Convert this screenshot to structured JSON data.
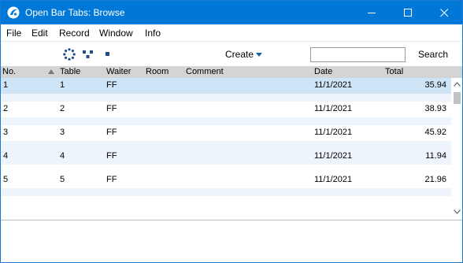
{
  "window": {
    "title": "Open Bar Tabs: Browse",
    "accent_color": "#0078d7",
    "icon": "app-logo-icon",
    "controls": [
      "minimize-icon",
      "maximize-icon",
      "close-icon"
    ]
  },
  "menu": {
    "file": "File",
    "edit": "Edit",
    "record": "Record",
    "window": "Window",
    "info": "Info"
  },
  "toolbar": {
    "icons": [
      "refresh-spinner-icon",
      "tree-view-icon",
      "square-icon"
    ],
    "create_label": "Create",
    "search_value": "",
    "search_label": "Search"
  },
  "table": {
    "columns": {
      "no": "No.",
      "table": "Table",
      "waiter": "Waiter",
      "room": "Room",
      "comment": "Comment",
      "date": "Date",
      "total": "Total"
    },
    "sort": "ascending",
    "rows": [
      {
        "no": "1",
        "table": "1",
        "waiter": "FF",
        "room": "",
        "comment": "",
        "date": "11/1/2021",
        "total": "35.94"
      },
      {
        "no": "2",
        "table": "2",
        "waiter": "FF",
        "room": "",
        "comment": "",
        "date": "11/1/2021",
        "total": "38.93"
      },
      {
        "no": "3",
        "table": "3",
        "waiter": "FF",
        "room": "",
        "comment": "",
        "date": "11/1/2021",
        "total": "45.92"
      },
      {
        "no": "4",
        "table": "4",
        "waiter": "FF",
        "room": "",
        "comment": "",
        "date": "11/1/2021",
        "total": "11.94"
      },
      {
        "no": "5",
        "table": "5",
        "waiter": "FF",
        "room": "",
        "comment": "",
        "date": "11/1/2021",
        "total": "21.96"
      }
    ]
  }
}
